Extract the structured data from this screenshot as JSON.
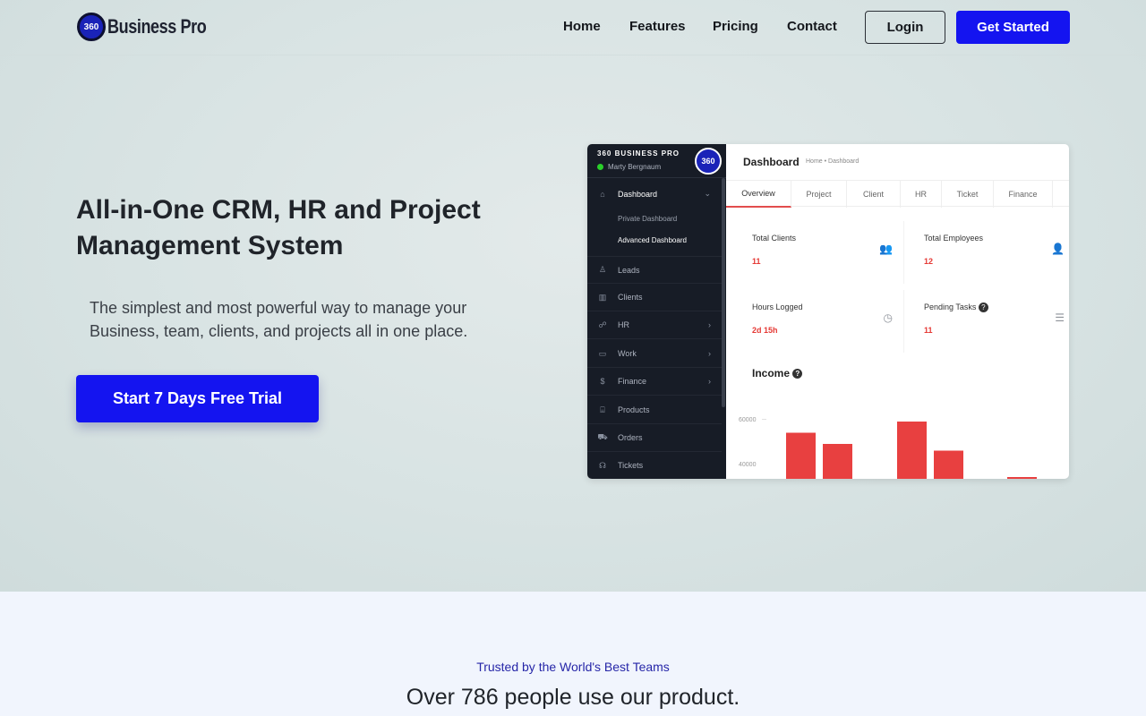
{
  "brand": {
    "name": "Business Pro",
    "badge": "360"
  },
  "nav": {
    "items": [
      "Home",
      "Features",
      "Pricing",
      "Contact"
    ],
    "login": "Login",
    "get_started": "Get Started"
  },
  "hero": {
    "title": "All-in-One CRM, HR and Project Management System",
    "subtitle": "The simplest and most powerful way to manage your Business, team, clients, and projects all in one place.",
    "cta": "Start 7 Days Free Trial"
  },
  "dashboard": {
    "brand": "360 BUSINESS PRO",
    "user": "Marty Bergnaum",
    "badge": "360",
    "title": "Dashboard",
    "breadcrumb": "Home • Dashboard",
    "menu": [
      {
        "label": "Dashboard",
        "icon": "home-icon",
        "chevron": true
      },
      {
        "label": "Leads",
        "icon": "user-icon",
        "chevron": false
      },
      {
        "label": "Clients",
        "icon": "building-icon",
        "chevron": false
      },
      {
        "label": "HR",
        "icon": "users-icon",
        "chevron": true
      },
      {
        "label": "Work",
        "icon": "briefcase-icon",
        "chevron": true
      },
      {
        "label": "Finance",
        "icon": "dollar-icon",
        "chevron": true
      },
      {
        "label": "Products",
        "icon": "basket-icon",
        "chevron": false
      },
      {
        "label": "Orders",
        "icon": "cart-icon",
        "chevron": false
      },
      {
        "label": "Tickets",
        "icon": "headset-icon",
        "chevron": false
      }
    ],
    "submenu": [
      "Private Dashboard",
      "Advanced Dashboard"
    ],
    "tabs": [
      "Overview",
      "Project",
      "Client",
      "HR",
      "Ticket",
      "Finance"
    ],
    "cards": [
      {
        "title": "Total Clients",
        "value": "11",
        "icon": "users-icon"
      },
      {
        "title": "Total Employees",
        "value": "12",
        "icon": "user-icon"
      },
      {
        "title": "Hours Logged",
        "value": "2d 15h",
        "icon": "clock-icon"
      },
      {
        "title": "Pending Tasks",
        "value": "11",
        "icon": "tasks-icon"
      }
    ],
    "income_title": "Income",
    "chart_data": {
      "type": "bar",
      "title": "Income",
      "y_ticks": [
        "60000",
        "40000"
      ],
      "values": [
        54000,
        49000,
        59000,
        46000,
        29000
      ],
      "color": "#e84040"
    }
  },
  "trusted": {
    "tagline": "Trusted by the World's Best Teams",
    "users": "Over 786 people use our product."
  }
}
